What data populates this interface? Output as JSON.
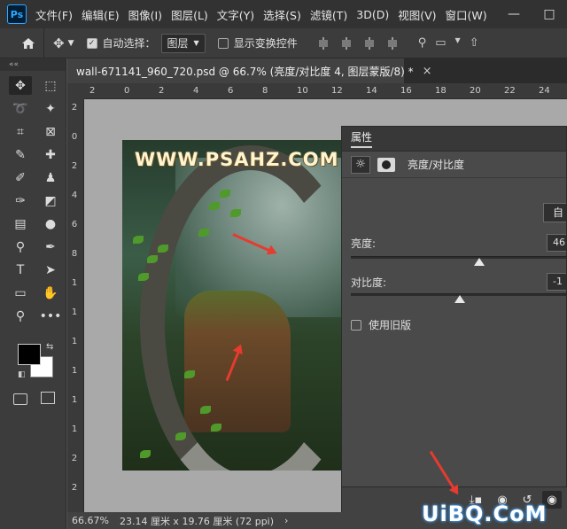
{
  "app": {
    "logo": "Ps"
  },
  "menu": {
    "items": [
      "文件(F)",
      "编辑(E)",
      "图像(I)",
      "图层(L)",
      "文字(Y)",
      "选择(S)",
      "滤镜(T)",
      "3D(D)",
      "视图(V)",
      "窗口(W)"
    ],
    "window_controls": {
      "minimize": "—",
      "maximize": "□",
      "close": "✕"
    }
  },
  "options_bar": {
    "auto_select_checked": true,
    "auto_select_label": "自动选择：",
    "auto_select_target": "图层",
    "show_transform_label": "显示变换控件",
    "show_transform_checked": false
  },
  "toolbar": {
    "collapse": "««",
    "tools": [
      {
        "name": "move-tool",
        "glyph": "✥",
        "active": true
      },
      {
        "name": "marquee-tool",
        "glyph": "⬚"
      },
      {
        "name": "lasso-tool",
        "glyph": "➰"
      },
      {
        "name": "magic-wand-tool",
        "glyph": "✦"
      },
      {
        "name": "crop-tool",
        "glyph": "⌗"
      },
      {
        "name": "frame-tool",
        "glyph": "⊠"
      },
      {
        "name": "eyedropper-tool",
        "glyph": "✎"
      },
      {
        "name": "healing-tool",
        "glyph": "✚"
      },
      {
        "name": "brush-tool",
        "glyph": "✐"
      },
      {
        "name": "stamp-tool",
        "glyph": "♟"
      },
      {
        "name": "history-brush-tool",
        "glyph": "✑"
      },
      {
        "name": "eraser-tool",
        "glyph": "◩"
      },
      {
        "name": "gradient-tool",
        "glyph": "▤"
      },
      {
        "name": "blur-tool",
        "glyph": "●"
      },
      {
        "name": "dodge-tool",
        "glyph": "⚲"
      },
      {
        "name": "pen-tool",
        "glyph": "✒"
      },
      {
        "name": "type-tool",
        "glyph": "T"
      },
      {
        "name": "path-select-tool",
        "glyph": "➤"
      },
      {
        "name": "shape-tool",
        "glyph": "▭"
      },
      {
        "name": "hand-tool",
        "glyph": "✋"
      },
      {
        "name": "zoom-tool",
        "glyph": "⚲"
      },
      {
        "name": "more-tools",
        "glyph": "•••"
      }
    ],
    "colors": {
      "foreground": "#000000",
      "background": "#ffffff"
    }
  },
  "document": {
    "tab_title": "wall-671141_960_720.psd @ 66.7% (亮度/对比度 4, 图层蒙版/8) *",
    "close": "×",
    "watermark_text": "WWW.PSAHZ.COM"
  },
  "rulers": {
    "h_ticks": [
      "2",
      "0",
      "2",
      "4",
      "6",
      "8",
      "10",
      "12",
      "14",
      "16",
      "18",
      "20",
      "22",
      "24"
    ],
    "v_ticks": [
      "2",
      "0",
      "2",
      "4",
      "6",
      "8",
      "1",
      "1",
      "1",
      "1",
      "1",
      "1",
      "2",
      "2"
    ]
  },
  "properties": {
    "tab": "属性",
    "adjustment_title": "亮度/对比度",
    "auto_button": "自动",
    "brightness_label": "亮度:",
    "brightness_value": "46",
    "brightness_fraction": 0.59,
    "contrast_label": "对比度:",
    "contrast_value": "-1",
    "contrast_fraction": 0.5,
    "use_legacy_label": "使用旧版",
    "use_legacy_checked": false,
    "footer_buttons": [
      "clip-to-layer",
      "view-previous",
      "reset",
      "visibility"
    ]
  },
  "status": {
    "zoom": "66.67%",
    "doc_size": "23.14 厘米 x 19.76 厘米 (72 ppi)",
    "arrow": "›"
  },
  "overlay": {
    "brand": "UiBQ.CoM",
    "arrow_color": "#e63b2e"
  }
}
